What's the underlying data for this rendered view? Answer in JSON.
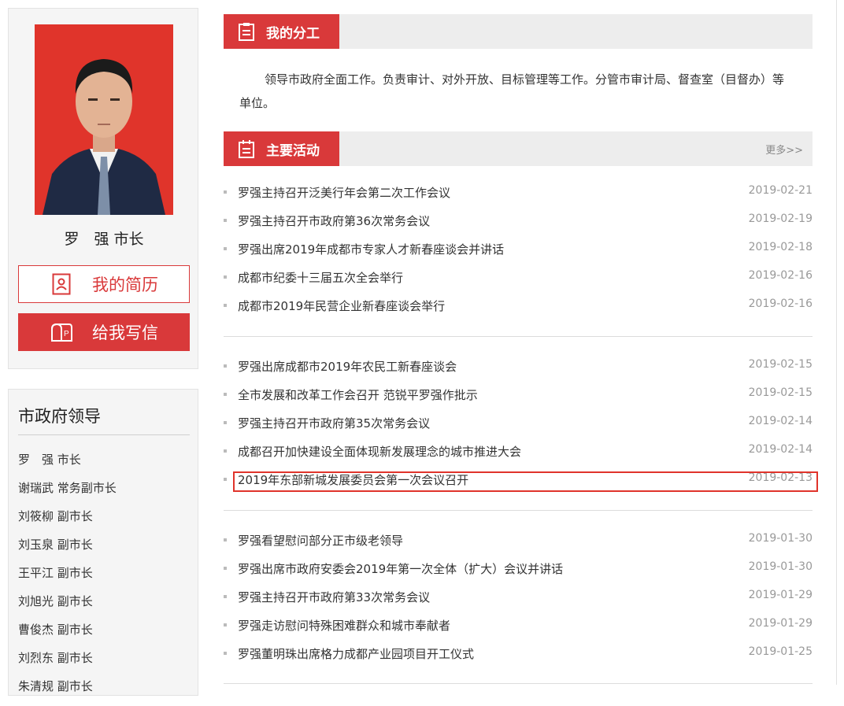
{
  "profile": {
    "name": "罗　强 市长",
    "resume_button": "我的简历",
    "letter_button": "给我写信"
  },
  "leaders": {
    "title": "市政府领导",
    "items": [
      "罗　强 市长",
      "谢瑞武 常务副市长",
      "刘筱柳 副市长",
      "刘玉泉 副市长",
      "王平江 副市长",
      "刘旭光 副市长",
      "曹俊杰 副市长",
      "刘烈东 副市长",
      "朱清规 副市长"
    ]
  },
  "duty_section": {
    "title": "我的分工",
    "text": "领导市政府全面工作。负责审计、对外开放、目标管理等工作。分管市审计局、督查室（目督办）等单位。"
  },
  "activities": {
    "title": "主要活动",
    "more": "更多>>",
    "groups": [
      [
        {
          "title": "罗强主持召开泛美行年会第二次工作会议",
          "date": "2019-02-21"
        },
        {
          "title": "罗强主持召开市政府第36次常务会议",
          "date": "2019-02-19"
        },
        {
          "title": "罗强出席2019年成都市专家人才新春座谈会并讲话",
          "date": "2019-02-18"
        },
        {
          "title": "成都市纪委十三届五次全会举行",
          "date": "2019-02-16"
        },
        {
          "title": "成都市2019年民营企业新春座谈会举行",
          "date": "2019-02-16"
        }
      ],
      [
        {
          "title": "罗强出席成都市2019年农民工新春座谈会",
          "date": "2019-02-15"
        },
        {
          "title": "全市发展和改革工作会召开 范锐平罗强作批示",
          "date": "2019-02-15"
        },
        {
          "title": "罗强主持召开市政府第35次常务会议",
          "date": "2019-02-14"
        },
        {
          "title": "成都召开加快建设全面体现新发展理念的城市推进大会",
          "date": "2019-02-14"
        },
        {
          "title": "2019年东部新城发展委员会第一次会议召开",
          "date": "2019-02-13"
        }
      ],
      [
        {
          "title": "罗强看望慰问部分正市级老领导",
          "date": "2019-01-30"
        },
        {
          "title": "罗强出席市政府安委会2019年第一次全体（扩大）会议并讲话",
          "date": "2019-01-30"
        },
        {
          "title": "罗强主持召开市政府第33次常务会议",
          "date": "2019-01-29"
        },
        {
          "title": "罗强走访慰问特殊困难群众和城市奉献者",
          "date": "2019-01-29"
        },
        {
          "title": "罗强董明珠出席格力成都产业园项目开工仪式",
          "date": "2019-01-25"
        }
      ]
    ]
  },
  "colors": {
    "accent": "#d9393a",
    "header_bg": "#ededed",
    "panel_bg": "#f5f5f5"
  },
  "icons": {
    "resume": "resume-icon",
    "letter": "mailbox-icon",
    "duty": "clipboard-icon",
    "activities": "calendar-list-icon"
  }
}
